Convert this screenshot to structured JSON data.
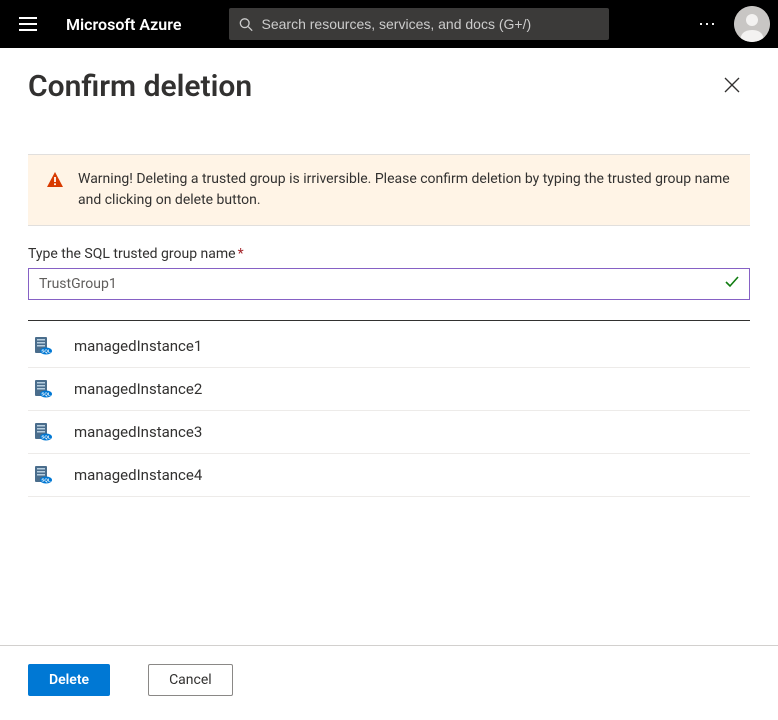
{
  "header": {
    "brand": "Microsoft Azure",
    "search_placeholder": "Search resources, services, and docs (G+/)"
  },
  "page": {
    "title": "Confirm deletion"
  },
  "warning": {
    "text": "Warning! Deleting a trusted group is irriversible. Please confirm deletion by typing the trusted group name and clicking on delete button."
  },
  "field": {
    "label": "Type the SQL trusted group name",
    "value": "TrustGroup1"
  },
  "instances": [
    {
      "name": "managedInstance1"
    },
    {
      "name": "managedInstance2"
    },
    {
      "name": "managedInstance3"
    },
    {
      "name": "managedInstance4"
    }
  ],
  "footer": {
    "delete_label": "Delete",
    "cancel_label": "Cancel"
  }
}
